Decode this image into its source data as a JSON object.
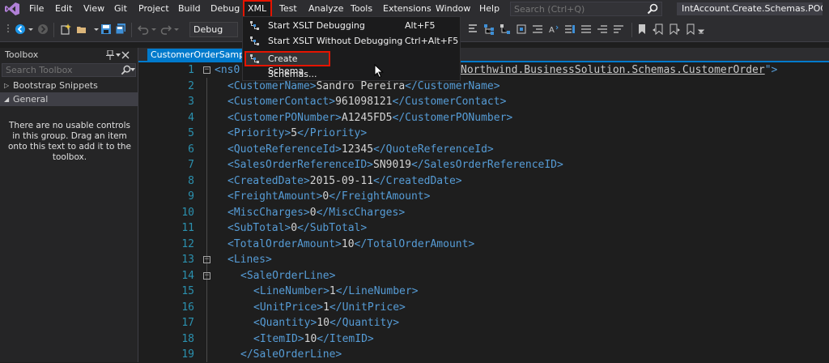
{
  "menubar": {
    "items": [
      "File",
      "Edit",
      "View",
      "Git",
      "Project",
      "Build",
      "Debug",
      "XML",
      "Test",
      "Analyze",
      "Tools",
      "Extensions",
      "Window",
      "Help"
    ],
    "search_placeholder": "Search (Ctrl+Q)",
    "solution_title": "IntAccount.Create.Schemas.POC"
  },
  "toolbar": {
    "configuration": "Debug"
  },
  "xml_menu": {
    "items": [
      {
        "label": "Start XSLT Debugging",
        "shortcut": "Alt+F5"
      },
      {
        "label": "Start XSLT Without Debugging",
        "shortcut": "Ctrl+Alt+F5"
      },
      {
        "label": "Create Schema",
        "shortcut": ""
      },
      {
        "label": "Schemas...",
        "shortcut": ""
      }
    ]
  },
  "toolbox": {
    "title": "Toolbox",
    "search_placeholder": "Search Toolbox",
    "groups": [
      "Bootstrap Snippets",
      "General"
    ],
    "empty_message": "There are no usable controls in this group. Drag an item onto this text to add it to the toolbox."
  },
  "editor": {
    "tab_title": "CustomerOrderSample.xml",
    "line1_start": "<ns0",
    "line1_namespace": "Northwind.BusinessSolution.Schemas.CustomerOrder",
    "line1_end": "\">",
    "lines": [
      {
        "n": "2",
        "open": "<CustomerName>",
        "value": "Sandro Pereira",
        "close": "</CustomerName>"
      },
      {
        "n": "3",
        "open": "<CustomerContact>",
        "value": "961098121",
        "close": "</CustomerContact>"
      },
      {
        "n": "4",
        "open": "<CustomerPONumber>",
        "value": "A1245FD5",
        "close": "</CustomerPONumber>"
      },
      {
        "n": "5",
        "open": "<Priority>",
        "value": "5",
        "close": "</Priority>"
      },
      {
        "n": "6",
        "open": "<QuoteReferenceId>",
        "value": "12345",
        "close": "</QuoteReferenceId>"
      },
      {
        "n": "7",
        "open": "<SalesOrderReferenceID>",
        "value": "SN9019",
        "close": "</SalesOrderReferenceID>"
      },
      {
        "n": "8",
        "open": "<CreatedDate>",
        "value": "2015-09-11",
        "close": "</CreatedDate>"
      },
      {
        "n": "9",
        "open": "<FreightAmount>",
        "value": "0",
        "close": "</FreightAmount>"
      },
      {
        "n": "10",
        "open": "<MiscCharges>",
        "value": "0",
        "close": "</MiscCharges>"
      },
      {
        "n": "11",
        "open": "<SubTotal>",
        "value": "0",
        "close": "</SubTotal>"
      },
      {
        "n": "12",
        "open": "<TotalOrderAmount>",
        "value": "10",
        "close": "</TotalOrderAmount>"
      },
      {
        "n": "13",
        "open": "<Lines>",
        "value": "",
        "close": ""
      },
      {
        "n": "14",
        "open": "<SaleOrderLine>",
        "value": "",
        "close": ""
      },
      {
        "n": "15",
        "open": "<LineNumber>",
        "value": "1",
        "close": "</LineNumber>"
      },
      {
        "n": "16",
        "open": "<UnitPrice>",
        "value": "1",
        "close": "</UnitPrice>"
      },
      {
        "n": "17",
        "open": "<Quantity>",
        "value": "10",
        "close": "</Quantity>"
      },
      {
        "n": "18",
        "open": "<ItemID>",
        "value": "10",
        "close": "</ItemID>"
      },
      {
        "n": "19",
        "open": "</SaleOrderLine>",
        "value": "",
        "close": ""
      }
    ]
  },
  "colors": {
    "accent": "#007acc",
    "highlight_border": "#e51400",
    "xml_tag": "#569cd6",
    "line_number": "#2b91af"
  }
}
